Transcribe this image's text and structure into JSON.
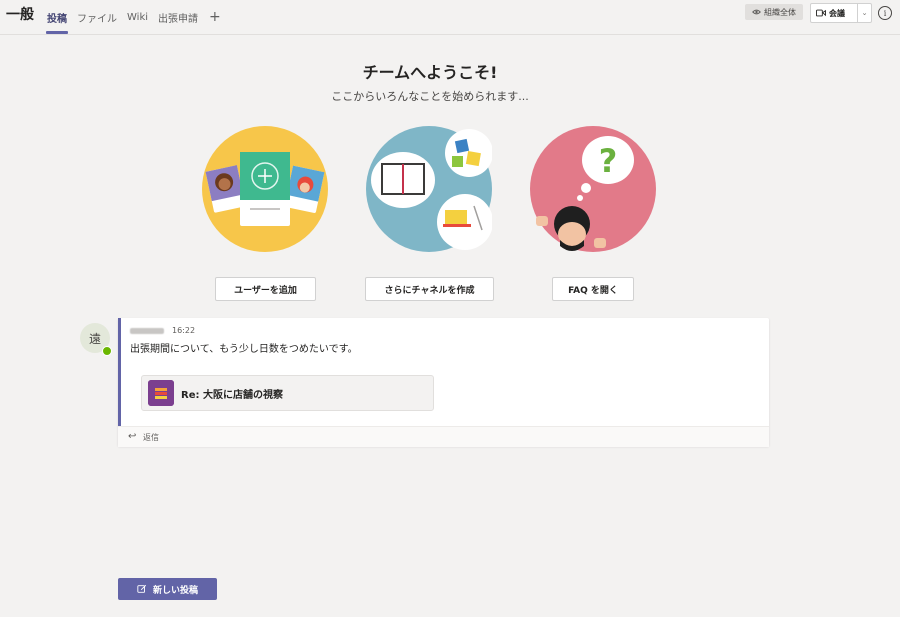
{
  "header": {
    "channel_name": "一般",
    "tabs": [
      {
        "label": "投稿",
        "active": true
      },
      {
        "label": "ファイル",
        "active": false
      },
      {
        "label": "Wiki",
        "active": false
      },
      {
        "label": "出張申請",
        "active": false
      }
    ],
    "add_tab": "+",
    "team_scope": "組織全体",
    "meet_label": "会議"
  },
  "welcome": {
    "title": "チームへようこそ!",
    "subtitle": "ここからいろんなことを始められます...",
    "actions": [
      {
        "label": "ユーザーを追加",
        "icon": "add-people-illustration"
      },
      {
        "label": "さらにチャネルを作成",
        "icon": "create-channel-illustration"
      },
      {
        "label": "FAQ を開く",
        "icon": "faq-illustration"
      }
    ]
  },
  "post": {
    "avatar_initial": "遠",
    "time": "16:22",
    "text": "出張期間について、もう少し日数をつめたいです。",
    "reference_title": "Re: 大阪に店舗の視察",
    "reply_label": "返信"
  },
  "footer": {
    "new_post_label": "新しい投稿"
  },
  "colors": {
    "accent": "#6264a7",
    "background": "#f3f2f1"
  }
}
